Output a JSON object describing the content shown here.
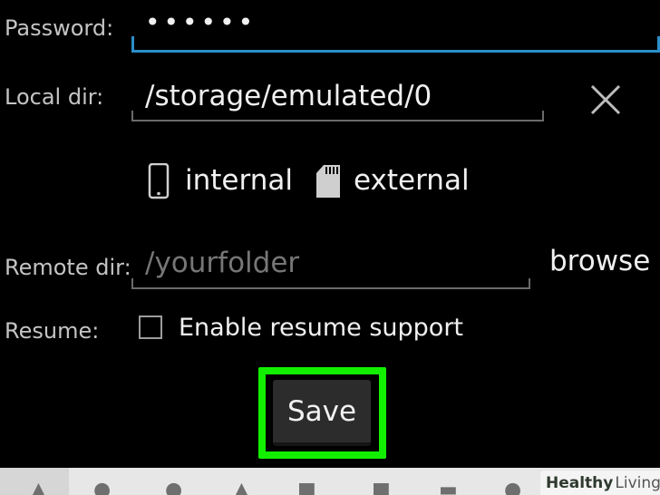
{
  "form": {
    "password_label": "Password:",
    "password_value": "••••••",
    "localdir_label": "Local dir:",
    "localdir_value": "/storage/emulated/0",
    "storage_internal_label": "internal",
    "storage_external_label": "external",
    "remotedir_label": "Remote dir:",
    "remotedir_placeholder": "/yourfolder",
    "browse_label": "browse",
    "resume_label": "Resume:",
    "resume_checkbox_label": "Enable resume support",
    "resume_checked": false,
    "save_label": "Save"
  },
  "colors": {
    "focus_underline": "#2b8fc9",
    "highlight_frame": "#12f000",
    "background": "#000000"
  },
  "watermark": {
    "brand_bold": "Healthy",
    "brand_light": "Living"
  },
  "icons": {
    "clear": "close-icon",
    "internal": "phone-icon",
    "external": "sd-card-icon",
    "watermark": "cross-icon"
  }
}
